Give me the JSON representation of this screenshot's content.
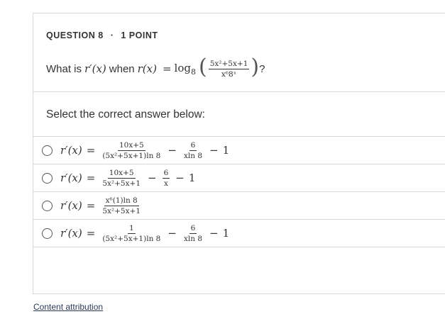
{
  "header": {
    "question_label": "QUESTION 8",
    "dot": "·",
    "points": "1 POINT"
  },
  "question": {
    "prefix": "What is",
    "mid": "when",
    "suffix": "?",
    "lhs": "r′(x)",
    "func": "r(x)",
    "log_base": "8",
    "fraction_numerator": "5x²+5x+1",
    "fraction_denominator": "x⁶8ˣ"
  },
  "prompt": "Select the correct answer below:",
  "options": [
    {
      "lhs": "r′(x)",
      "t1_num": "10x+5",
      "t1_den": "(5x²+5x+1)ln 8",
      "op1": "−",
      "t2_num": "6",
      "t2_den": "xln 8",
      "op2": "−",
      "t3": "1"
    },
    {
      "lhs": "r′(x)",
      "t1_num": "10x+5",
      "t1_den": "5x²+5x+1",
      "op1": "−",
      "t2_num": "6",
      "t2_den": "x",
      "op2": "−",
      "t3": "1"
    },
    {
      "lhs": "r′(x)",
      "t1_num": "x⁶(1)ln 8",
      "t1_den": "5x²+5x+1"
    },
    {
      "lhs": "r′(x)",
      "t1_num": "1",
      "t1_den": "(5x²+5x+1)ln 8",
      "op1": "−",
      "t2_num": "6",
      "t2_den": "xln 8",
      "op2": "−",
      "t3": "1"
    }
  ],
  "footer": {
    "attribution": "Content attribution"
  }
}
